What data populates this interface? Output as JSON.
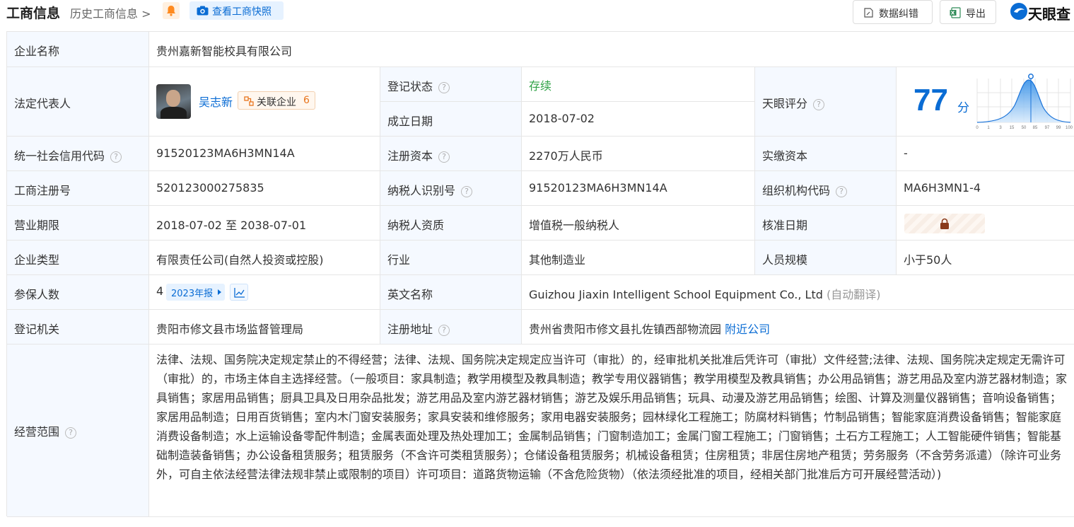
{
  "header": {
    "title": "工商信息",
    "history_label": "历史工商信息 >",
    "snapshot_label": "查看工商快照",
    "report_error_label": "数据纠错",
    "export_label": "导出",
    "logo_text": "天眼查"
  },
  "info": {
    "company_name_label": "企业名称",
    "company_name": "贵州嘉新智能校具有限公司",
    "legal_rep_label": "法定代表人",
    "legal_rep_name": "吴志新",
    "related_label": "关联企业",
    "related_count": "6",
    "reg_status_label": "登记状态",
    "reg_status": "存续",
    "found_date_label": "成立日期",
    "found_date": "2018-07-02",
    "tianyan_score_label": "天眼评分",
    "score": "77",
    "score_unit": "分",
    "credit_code_label": "统一社会信用代码",
    "credit_code": "91520123MA6H3MN14A",
    "reg_capital_label": "注册资本",
    "reg_capital": "2270万人民币",
    "paid_capital_label": "实缴资本",
    "paid_capital": "-",
    "biz_reg_no_label": "工商注册号",
    "biz_reg_no": "520123000275835",
    "taxpayer_id_label": "纳税人识别号",
    "taxpayer_id": "91520123MA6H3MN14A",
    "org_code_label": "组织机构代码",
    "org_code": "MA6H3MN1-4",
    "biz_term_label": "营业期限",
    "biz_term": "2018-07-02 至 2038-07-01",
    "taxpayer_qual_label": "纳税人资质",
    "taxpayer_qual": "增值税一般纳税人",
    "approval_date_label": "核准日期",
    "company_type_label": "企业类型",
    "company_type": "有限责任公司(自然人投资或控股)",
    "industry_label": "行业",
    "industry": "其他制造业",
    "staff_size_label": "人员规模",
    "staff_size": "小于50人",
    "insured_label": "参保人数",
    "insured_count": "4",
    "insured_year": "2023年报",
    "english_name_label": "英文名称",
    "english_name": "Guizhou Jiaxin Intelligent School Equipment Co., Ltd",
    "auto_translate": "(自动翻译)",
    "reg_authority_label": "登记机关",
    "reg_authority": "贵阳市修文县市场监督管理局",
    "reg_address_label": "注册地址",
    "reg_address": "贵州省贵阳市修文县扎佐镇西部物流园",
    "nearby_label": "附近公司",
    "biz_scope_label": "经营范围",
    "biz_scope": "法律、法规、国务院决定规定禁止的不得经营；法律、法规、国务院决定规定应当许可（审批）的，经审批机关批准后凭许可（审批）文件经营;法律、法规、国务院决定规定无需许可（审批）的，市场主体自主选择经营。（一般项目：家具制造；教学用模型及教具制造；教学专用仪器销售；教学用模型及教具销售；办公用品销售；游艺用品及室内游艺器材制造；家具销售；家居用品销售；厨具卫具及日用杂品批发；游艺用品及室内游艺器材销售；游艺及娱乐用品销售；玩具、动漫及游艺用品销售；绘图、计算及测量仪器销售；音响设备销售；家居用品制造；日用百货销售；室内木门窗安装服务；家具安装和维修服务；家用电器安装服务；园林绿化工程施工；防腐材料销售；竹制品销售；智能家庭消费设备销售；智能家庭消费设备制造；水上运输设备零配件制造；金属表面处理及热处理加工；金属制品销售；门窗制造加工；金属门窗工程施工；门窗销售；土石方工程施工；人工智能硬件销售；智能基础制造装备销售；办公设备租赁服务；租赁服务（不含许可类租赁服务）；仓储设备租赁服务；机械设备租赁；住房租赁；非居住房地产租赁；劳务服务（不含劳务派遣）（除许可业务外，可自主依法经营法律法规非禁止或限制的项目）许可项目：道路货物运输（不含危险货物）（依法须经批准的项目，经相关部门批准后方可开展经营活动）)"
  },
  "score_chart": {
    "tick_labels": [
      "0",
      "1",
      "3",
      "15",
      "50",
      "85",
      "97",
      "99",
      "100"
    ]
  },
  "colors": {
    "accent": "#0a6cd4",
    "status_green": "#30a247",
    "label_bg": "#f5f9ff"
  }
}
